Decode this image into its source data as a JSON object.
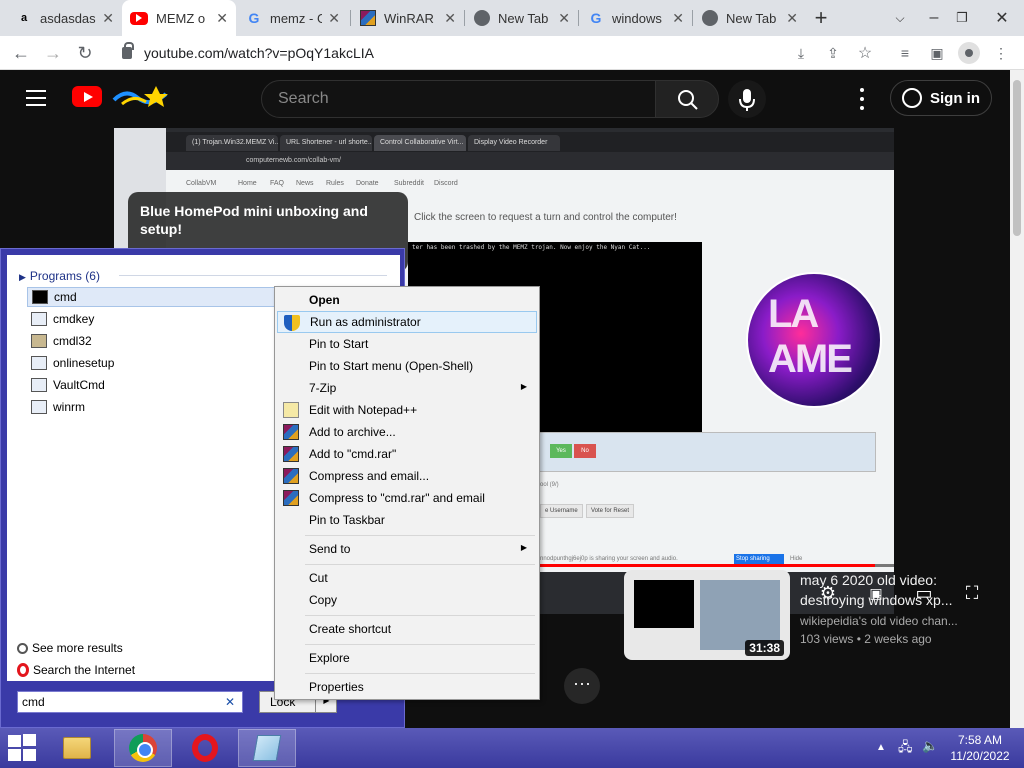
{
  "browser": {
    "tabs": [
      {
        "title": "asdasdas",
        "icon": "amazon-icon"
      },
      {
        "title": "MEMZ o",
        "icon": "youtube-icon"
      },
      {
        "title": "memz - G",
        "icon": "google-icon"
      },
      {
        "title": "WinRAR",
        "icon": "winrar-icon"
      },
      {
        "title": "New Tab",
        "icon": "chrome-icon"
      },
      {
        "title": "windows",
        "icon": "google-icon"
      },
      {
        "title": "New Tab",
        "icon": "chrome-icon"
      }
    ],
    "url": "youtube.com/watch?v=pOqY1akcLIA"
  },
  "youtube": {
    "search_placeholder": "Search",
    "signin_label": "Sign in",
    "video": {
      "card_title": "Blue HomePod mini unboxing and setup!",
      "inner_title": "Click the screen to request a turn and control the computer!",
      "inner_cmd": "ter has been trashed by the MEMZ trojan. Now enjoy the Nyan Cat...",
      "inner_tabs": [
        "(1) Trojan.Win32.MEMZ Vi...",
        "URL Shortener - url shorte...",
        "Control Collaborative Virt...",
        "Display Video Recorder"
      ],
      "inner_url": "computernewb.com/collab-vm/",
      "inner_nav": [
        "CollabVM",
        "Home",
        "FAQ",
        "News",
        "Rules",
        "Donate",
        "Subreddit",
        "Discord"
      ],
      "inner_yes": "Yes",
      "inner_no": "No",
      "inner_vote": "ool (9/)",
      "inner_username": "e Username",
      "inner_reset": "Vote for Reset",
      "inner_sharing": "nnodpunthgj6ej0p is sharing your screen and audio.",
      "inner_stop": "Stop sharing",
      "inner_hide": "Hide",
      "avatar_text": "LA AME",
      "progress": 0.95,
      "cc_label": "CC"
    },
    "recommendation": {
      "title": "may 6 2020 old video: destroying windows xp...",
      "channel": "wikiepeidia's old video chan...",
      "meta": "103 views • 2 weeks ago",
      "duration": "31:38"
    }
  },
  "start_menu": {
    "programs_header": "Programs (6)",
    "programs": [
      "cmd",
      "cmdkey",
      "cmdl32",
      "onlinesetup",
      "VaultCmd",
      "winrm"
    ],
    "see_more": "See more results",
    "search_internet": "Search the Internet",
    "search_value": "cmd",
    "lock_label": "Lock"
  },
  "context_menu": {
    "items": [
      {
        "label": "Open",
        "bold": true
      },
      {
        "label": "Run as administrator",
        "icon": "shield-icon"
      },
      {
        "label": "Pin to Start"
      },
      {
        "label": "Pin to Start menu (Open-Shell)"
      },
      {
        "label": "7-Zip",
        "submenu": true
      },
      {
        "label": "Edit with Notepad++",
        "icon": "notepadpp-icon"
      },
      {
        "label": "Add to archive...",
        "icon": "winrar-icon"
      },
      {
        "label": "Add to \"cmd.rar\"",
        "icon": "winrar-icon"
      },
      {
        "label": "Compress and email...",
        "icon": "winrar-icon"
      },
      {
        "label": "Compress to \"cmd.rar\" and email",
        "icon": "winrar-icon"
      },
      {
        "label": "Pin to Taskbar"
      },
      {
        "label": "Send to",
        "submenu": true
      },
      {
        "label": "Cut"
      },
      {
        "label": "Copy"
      },
      {
        "label": "Create shortcut"
      },
      {
        "label": "Explore"
      },
      {
        "label": "Properties"
      }
    ]
  },
  "taskbar": {
    "time": "7:58 AM",
    "date": "11/20/2022"
  },
  "colors": {
    "youtube_red": "#ff0000",
    "start_menu_border": "#3a3aa8",
    "context_highlight": "#e5f1fb"
  }
}
